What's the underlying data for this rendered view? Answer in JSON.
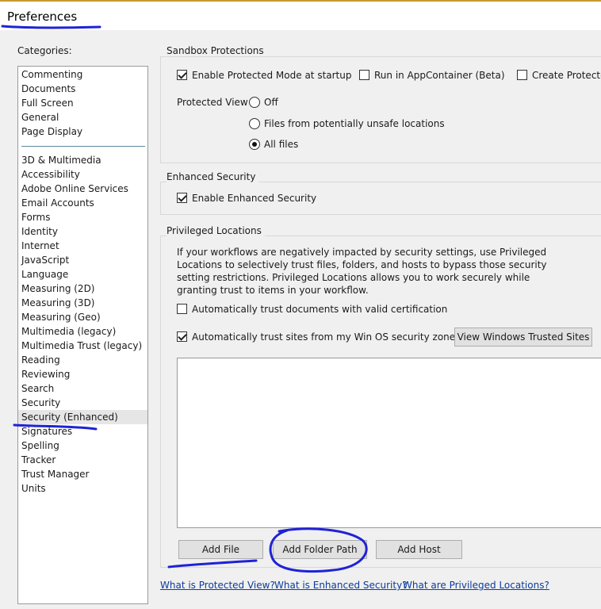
{
  "window": {
    "title": "Preferences"
  },
  "categories": {
    "label": "Categories:",
    "group1": [
      "Commenting",
      "Documents",
      "Full Screen",
      "General",
      "Page Display"
    ],
    "group2": [
      "3D & Multimedia",
      "Accessibility",
      "Adobe Online Services",
      "Email Accounts",
      "Forms",
      "Identity",
      "Internet",
      "JavaScript",
      "Language",
      "Measuring (2D)",
      "Measuring (3D)",
      "Measuring (Geo)",
      "Multimedia (legacy)",
      "Multimedia Trust (legacy)",
      "Reading",
      "Reviewing",
      "Search",
      "Security",
      "Security (Enhanced)",
      "Signatures",
      "Spelling",
      "Tracker",
      "Trust Manager",
      "Units"
    ],
    "selected": "Security (Enhanced)"
  },
  "sandbox": {
    "title": "Sandbox Protections",
    "protected_mode": {
      "label": "Enable Protected Mode at startup",
      "checked": true
    },
    "app_container": {
      "label": "Run in AppContainer (Beta)",
      "checked": false
    },
    "create_protected": {
      "label": "Create Protected",
      "checked": false
    },
    "protected_view_label": "Protected View",
    "options": [
      {
        "label": "Off",
        "selected": false
      },
      {
        "label": "Files from potentially unsafe locations",
        "selected": false
      },
      {
        "label": "All files",
        "selected": true
      }
    ]
  },
  "enhanced": {
    "title": "Enhanced Security",
    "enable": {
      "label": "Enable Enhanced Security",
      "checked": true
    }
  },
  "privileged": {
    "title": "Privileged Locations",
    "description": "If your workflows are negatively impacted by security settings, use Privileged Locations to selectively trust files, folders, and hosts to bypass those security setting restrictions. Privileged Locations allows you to work securely while granting trust to items in your workflow.",
    "trust_cert": {
      "label": "Automatically trust documents with valid certification",
      "checked": false
    },
    "trust_sites": {
      "label": "Automatically trust sites from my Win OS security zones",
      "checked": true
    },
    "view_trusted_sites_button": "View Windows Trusted Sites",
    "add_file_button": "Add File",
    "add_folder_button": "Add Folder Path",
    "add_host_button": "Add Host"
  },
  "links": {
    "protected_view": "What is Protected View?",
    "enhanced_security": "What is Enhanced Security?",
    "privileged_locations": "What are Privileged Locations?"
  },
  "colors": {
    "annotation": "#1f23d6",
    "accent_line": "#c49a32",
    "link": "#0b3ca0"
  }
}
